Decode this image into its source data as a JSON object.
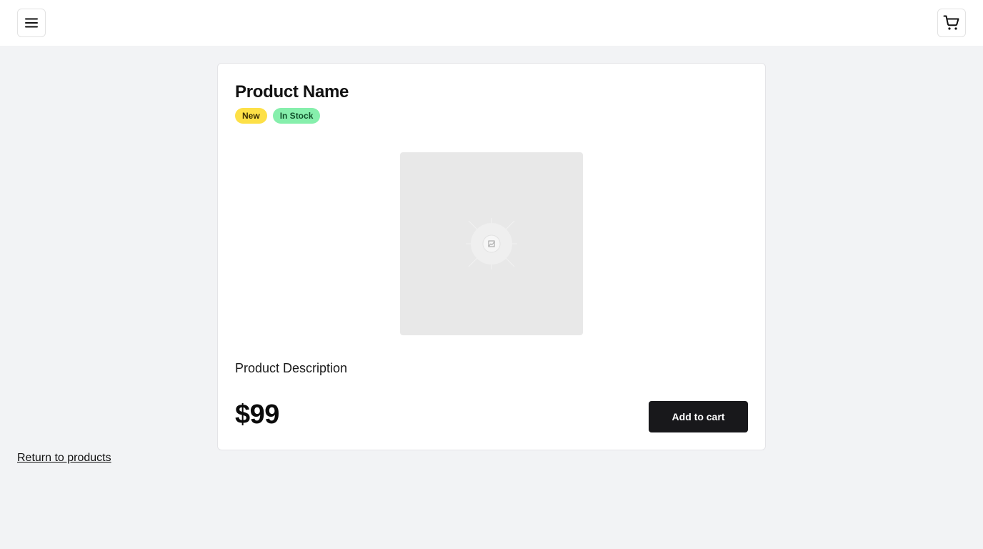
{
  "header": {
    "menu_icon": "menu-icon",
    "cart_icon": "shopping-cart-icon"
  },
  "product": {
    "name": "Product Name",
    "badges": [
      {
        "label": "New",
        "color": "#fde047"
      },
      {
        "label": "In Stock",
        "color": "#86efac"
      }
    ],
    "image_icon": "image-placeholder-icon",
    "description": "Product Description",
    "price": "$99",
    "add_to_cart_label": "Add to cart"
  },
  "footer": {
    "return_link": "Return to products"
  },
  "colors": {
    "background": "#f2f3f5",
    "button": "#18181b"
  }
}
